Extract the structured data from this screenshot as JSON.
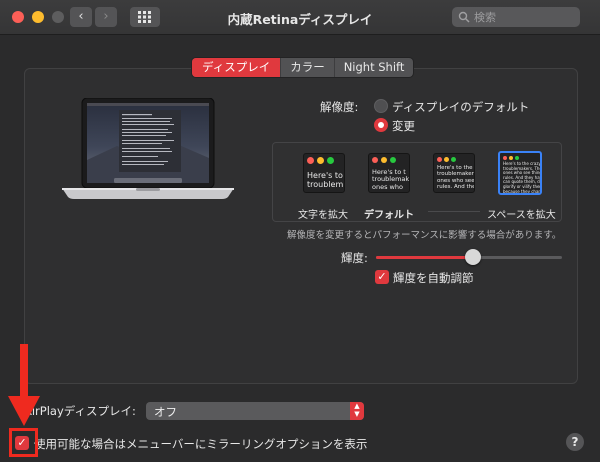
{
  "window": {
    "title": "内蔵Retinaディスプレイ",
    "nav_back": "‹",
    "nav_forward": "›",
    "search_placeholder": "検索"
  },
  "tabs": [
    {
      "label": "ディスプレイ",
      "active": true
    },
    {
      "label": "カラー",
      "active": false
    },
    {
      "label": "Night Shift",
      "active": false
    }
  ],
  "resolution": {
    "label": "解像度:",
    "options": [
      {
        "label": "ディスプレイのデフォルト",
        "selected": false
      },
      {
        "label": "変更",
        "selected": true
      }
    ],
    "scale_options": [
      {
        "label": "文字を拡大",
        "preview": "Here's to\ntroublem",
        "selected": false
      },
      {
        "label": "デフォルト",
        "preview": "Here's to t\ntroublemakers\nones who",
        "selected": false
      },
      {
        "label": "",
        "preview": "Here's to the\ntroublemakers\nones who see t\nrules. And they",
        "selected": false
      },
      {
        "label": "スペースを拡大",
        "preview": "Here's to the crazy one\ntroublemakers. The ro\nones who see things d\nrules. And they have n\ncan quote them, disgr\nglorify or vilify them.\nbecause they change\nhuman race forward.",
        "selected": true
      }
    ],
    "note": "解像度を変更するとパフォーマンスに影響する場合があります。"
  },
  "brightness": {
    "label": "輝度:",
    "value": 0.52,
    "auto_checked": true,
    "auto_label": "輝度を自動調節"
  },
  "airplay": {
    "label": "AirPlayディスプレイ:",
    "value": "オフ"
  },
  "mirroring": {
    "checked": true,
    "label": "使用可能な場合はメニューバーにミラーリングオプションを表示"
  },
  "help_label": "?",
  "colors": {
    "accent": "#e0393e",
    "annotation": "#ef2a1f"
  }
}
